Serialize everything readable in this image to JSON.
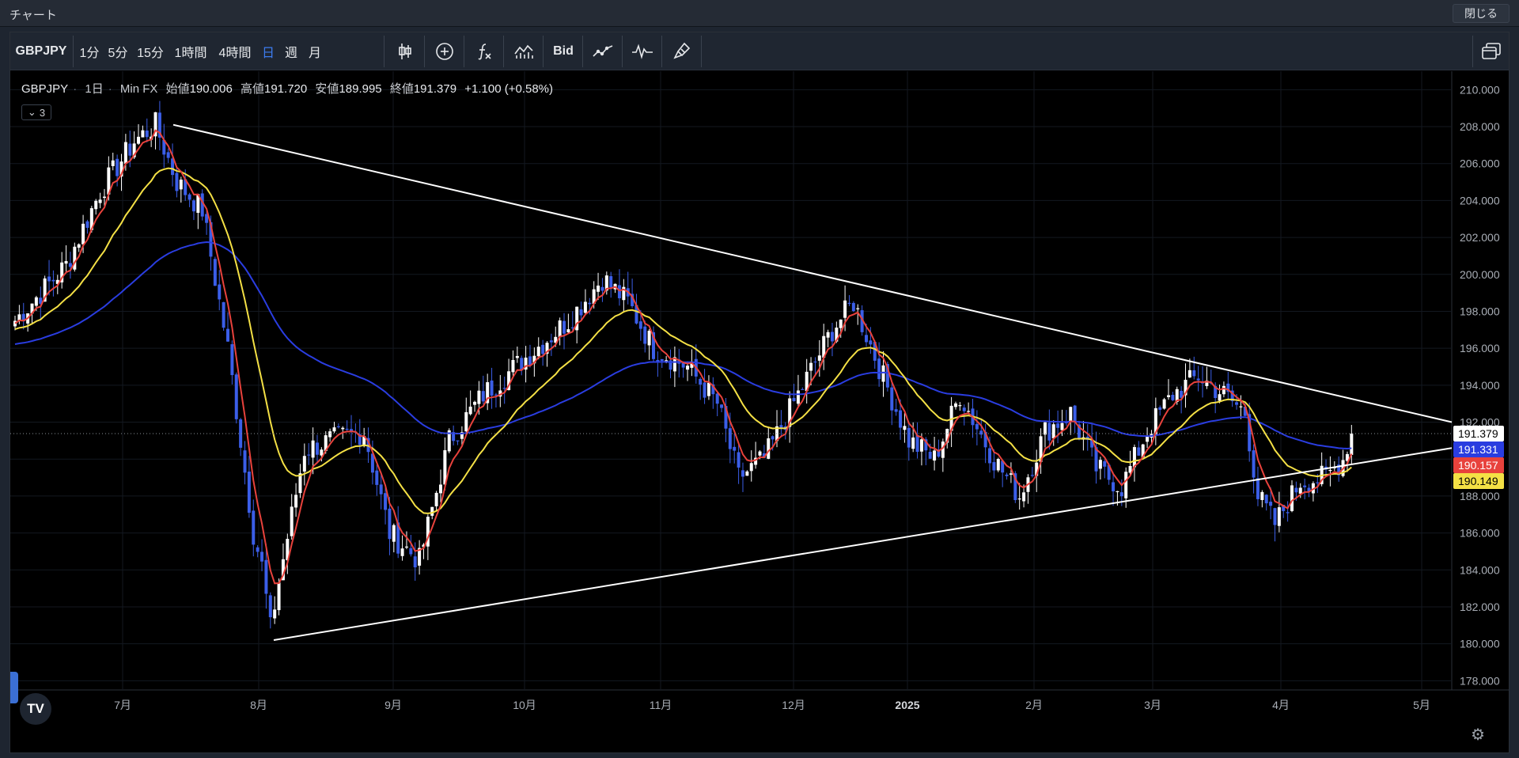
{
  "window": {
    "title": "チャート",
    "close_label": "閉じる"
  },
  "toolbar": {
    "symbol": "GBPJPY",
    "intervals": [
      "1分",
      "5分",
      "15分",
      "1時間",
      "4時間",
      "日",
      "週",
      "月"
    ],
    "active_interval": "日",
    "bid_label": "Bid",
    "icons": [
      "candles-icon",
      "add-indicator-icon",
      "function-icon",
      "compare-icon",
      "bid-label",
      "line-chart-icon",
      "waveform-icon",
      "brush-icon",
      "layout-icon"
    ]
  },
  "legend": {
    "symbol": "GBPJPY",
    "interval": "1日",
    "source": "Min FX",
    "open_label": "始値",
    "open": "190.006",
    "high_label": "高値",
    "high": "191.720",
    "low_label": "安値",
    "low": "189.995",
    "close_label": "終値",
    "close": "191.379",
    "change": "+1.100 (+0.58%)",
    "indicators_count": "3"
  },
  "logo": "TV",
  "chart_data": {
    "type": "candlestick",
    "symbol": "GBPJPY",
    "interval": "1日",
    "ylim": [
      177.5,
      211
    ],
    "y_ticks": [
      178,
      180,
      182,
      184,
      186,
      188,
      190,
      192,
      194,
      196,
      198,
      200,
      202,
      204,
      206,
      208,
      210
    ],
    "y_tick_labels": [
      "178.000",
      "180.000",
      "182.000",
      "184.000",
      "186.000",
      "188.000",
      "190.000",
      "192.000",
      "194.000",
      "196.000",
      "198.000",
      "200.000",
      "202.000",
      "204.000",
      "206.000",
      "208.000",
      "210.000"
    ],
    "x_labels": [
      "7月",
      "8月",
      "9月",
      "10月",
      "11月",
      "12月",
      "2025",
      "2月",
      "3月",
      "4月",
      "5月"
    ],
    "price_labels": [
      {
        "value": 191.379,
        "text": "191.379",
        "bg": "#ffffff",
        "fg": "#000000"
      },
      {
        "value": 191.331,
        "text": "191.331",
        "bg": "#2a3de0",
        "fg": "#ffffff"
      },
      {
        "value": 190.157,
        "text": "190.157",
        "bg": "#e8423c",
        "fg": "#ffffff"
      },
      {
        "value": 190.149,
        "text": "190.149",
        "bg": "#f4e045",
        "fg": "#000000"
      }
    ],
    "last_price": 191.379,
    "up_color": "#ffffff",
    "down_color": "#3b5ee8",
    "ma_colors": {
      "fast": "#e8423c",
      "mid": "#f4e045",
      "slow": "#2a3de0"
    },
    "trendlines": [
      {
        "from": [
          "7月上旬",
          208.1
        ],
        "to": [
          "5月",
          192.0
        ]
      },
      {
        "from": [
          "8月上旬",
          180.2
        ],
        "to": [
          "5月",
          190.6
        ]
      }
    ],
    "candle_path": [
      [
        0,
        197.5
      ],
      [
        12,
        200.5
      ],
      [
        20,
        204.5
      ],
      [
        28,
        207.2
      ],
      [
        33,
        208.1
      ],
      [
        38,
        205.0
      ],
      [
        44,
        203.5
      ],
      [
        50,
        196.0
      ],
      [
        56,
        186.0
      ],
      [
        58,
        184.2
      ],
      [
        60,
        180.8
      ],
      [
        62,
        183.4
      ],
      [
        68,
        190.5
      ],
      [
        74,
        191.0
      ],
      [
        82,
        191.5
      ],
      [
        88,
        186.0
      ],
      [
        95,
        184.5
      ],
      [
        102,
        191.0
      ],
      [
        110,
        193.5
      ],
      [
        120,
        195.5
      ],
      [
        130,
        197.5
      ],
      [
        138,
        199.8
      ],
      [
        144,
        198.5
      ],
      [
        150,
        196.0
      ],
      [
        158,
        195.0
      ],
      [
        165,
        193.0
      ],
      [
        170,
        189.0
      ],
      [
        176,
        190.0
      ],
      [
        184,
        193.5
      ],
      [
        192,
        197.0
      ],
      [
        197,
        198.5
      ],
      [
        203,
        195.0
      ],
      [
        210,
        191.0
      ],
      [
        216,
        190.0
      ],
      [
        222,
        193.5
      ],
      [
        230,
        190.0
      ],
      [
        236,
        188.0
      ],
      [
        242,
        191.5
      ],
      [
        248,
        192.5
      ],
      [
        254,
        189.5
      ],
      [
        260,
        188.5
      ],
      [
        266,
        191.5
      ],
      [
        272,
        193.5
      ],
      [
        278,
        194.5
      ],
      [
        284,
        193.5
      ],
      [
        289,
        192.5
      ],
      [
        292,
        188.0
      ],
      [
        296,
        186.5
      ],
      [
        302,
        188.8
      ],
      [
        308,
        189.0
      ],
      [
        312,
        190.0
      ],
      [
        314,
        191.5
      ]
    ]
  }
}
